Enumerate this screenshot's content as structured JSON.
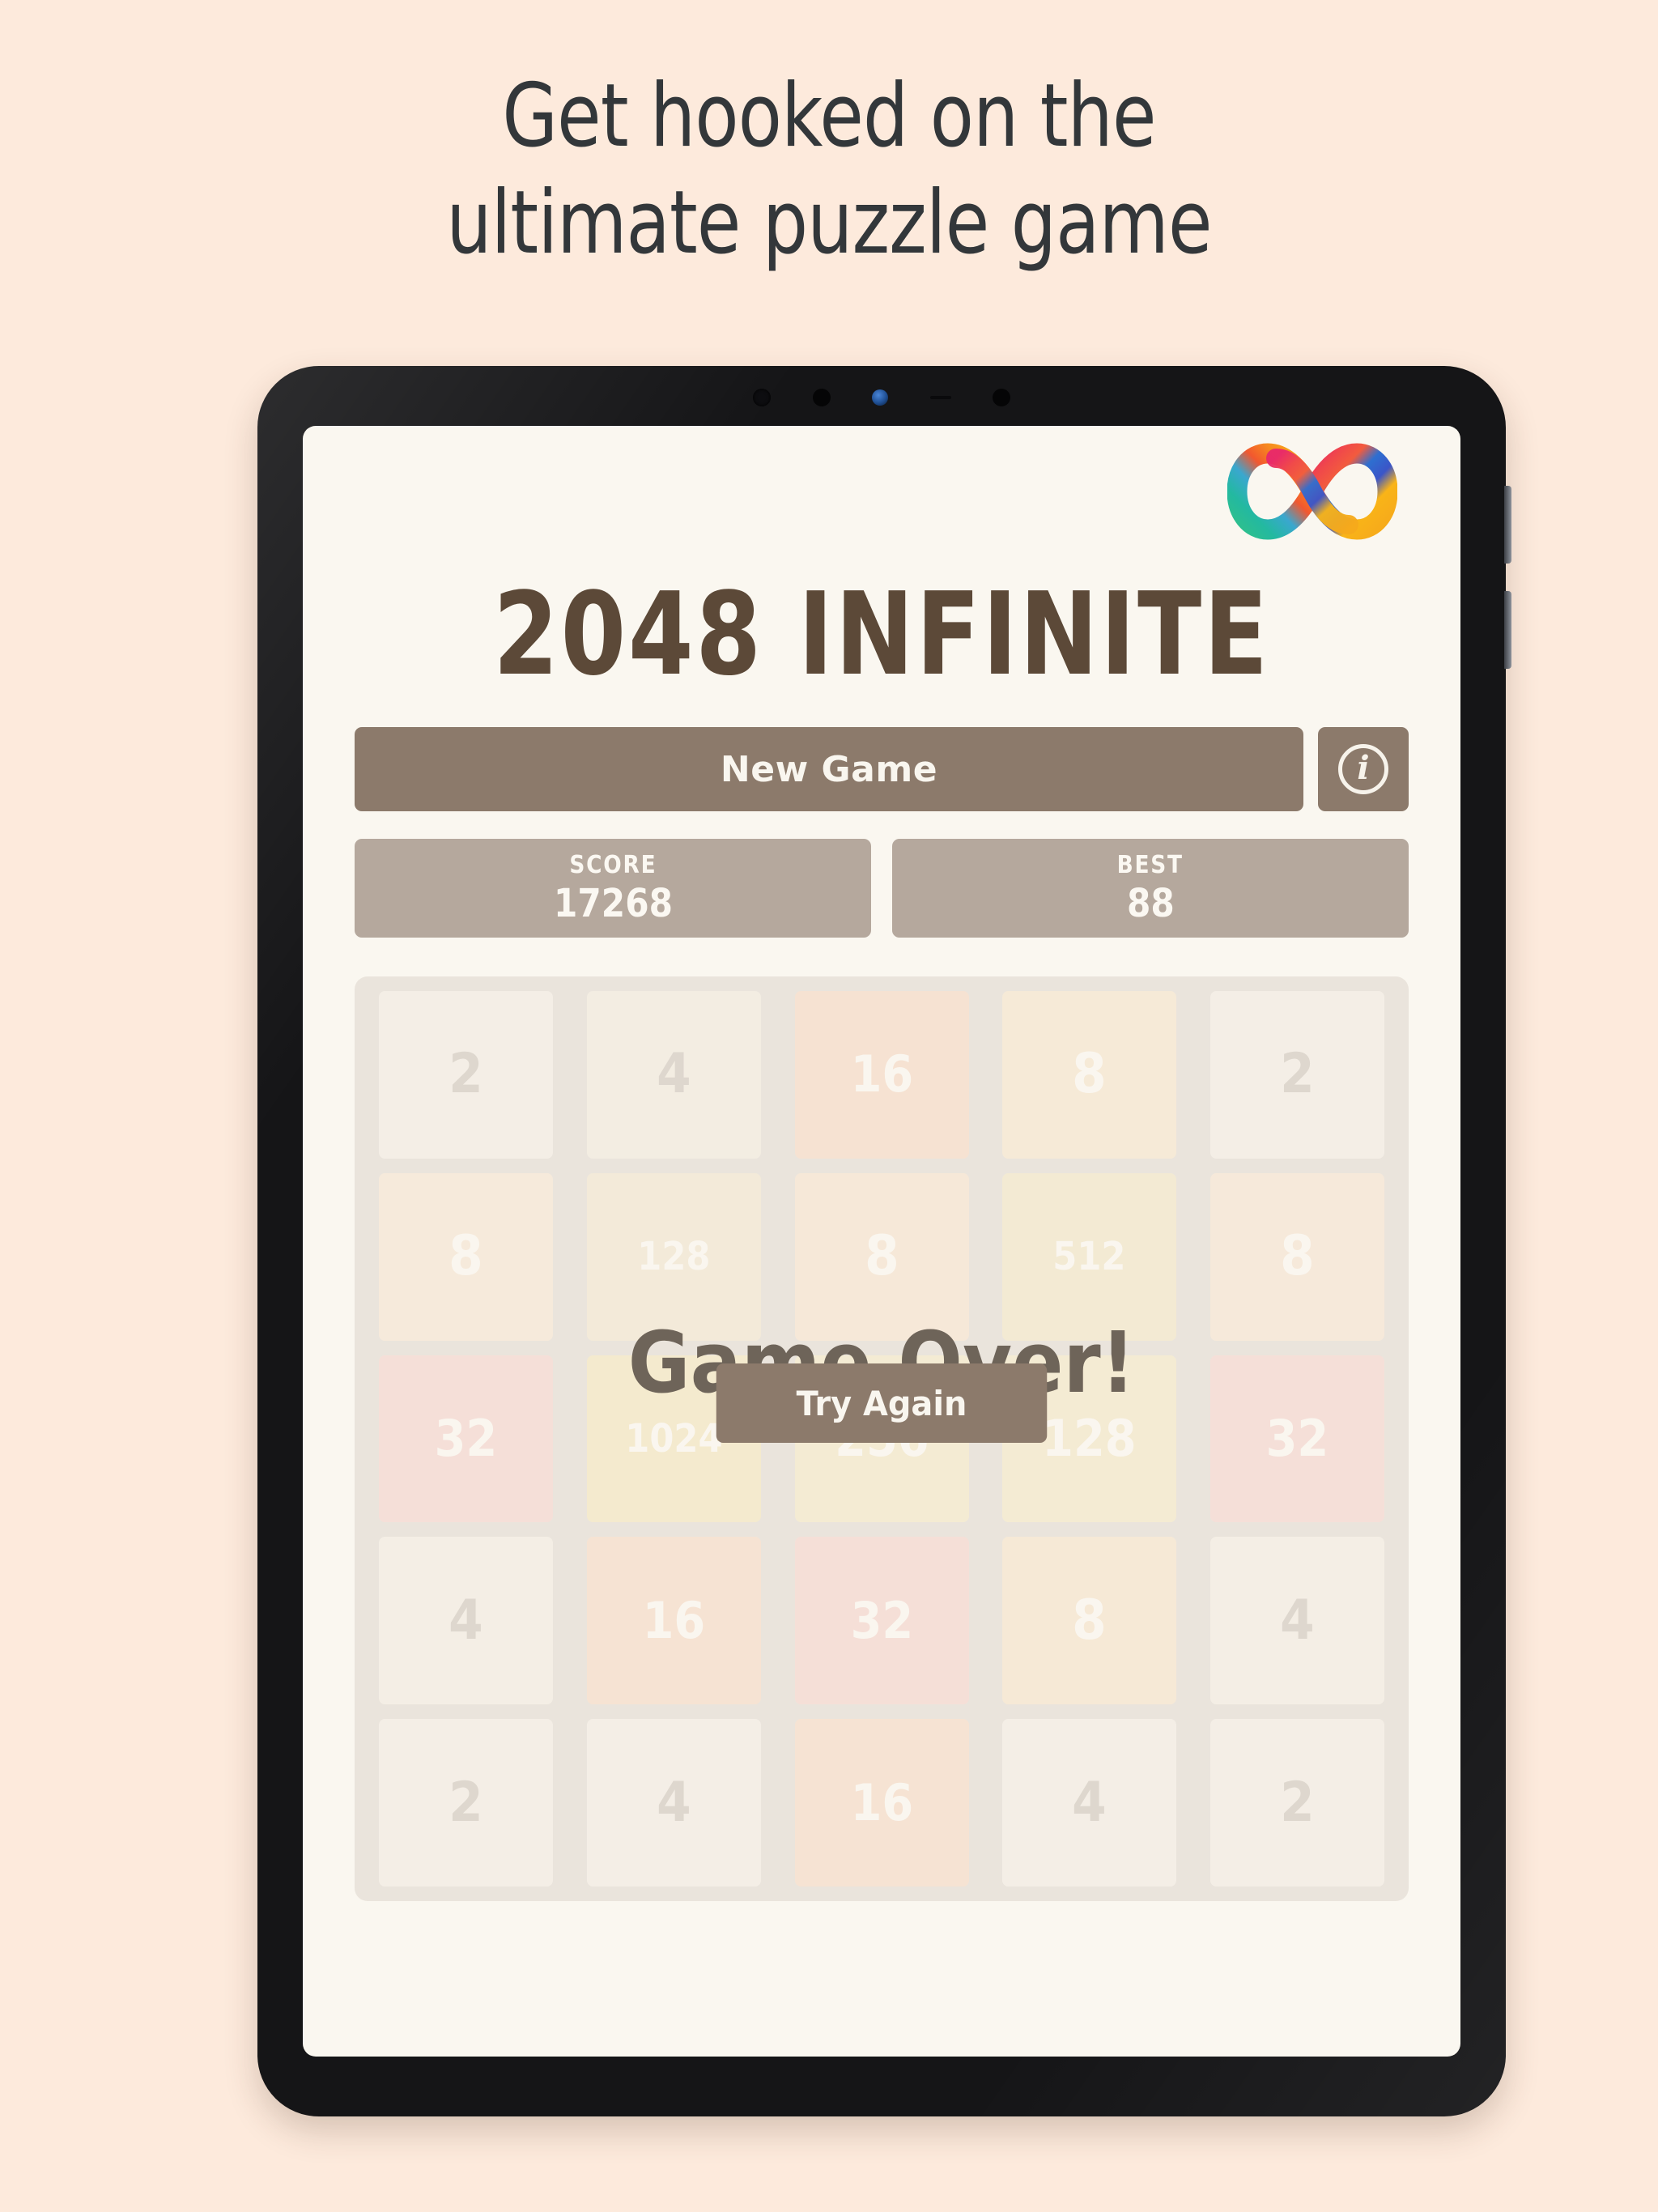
{
  "promo": {
    "headline_line1": "Get hooked on the",
    "headline_line2": "ultimate puzzle game",
    "background_color": "#FDEADC",
    "headline_color": "#33373A"
  },
  "device": {
    "type": "tablet",
    "bezel_color": "#151517",
    "screen_background": "#FAF7F0",
    "camera_icons": [
      "camera-dot",
      "camera-dot",
      "proximity-sensor",
      "camera-dot"
    ],
    "side_buttons": [
      "volume-up-button",
      "volume-down-button"
    ]
  },
  "app": {
    "logo_icon": "infinity-logo-icon",
    "logo_colors": [
      "#E8276B",
      "#F0474B",
      "#F47A20",
      "#F9B418",
      "#2E6FD0",
      "#18A48C",
      "#2FC08B"
    ],
    "title": "2048 INFINITE",
    "title_color": "#5C4938",
    "accent_color": "#8C7A6B",
    "score_box_color": "#B5A89D"
  },
  "toolbar": {
    "new_game_label": "New Game",
    "info_icon": "info-circle-icon",
    "info_glyph": "i"
  },
  "scores": [
    {
      "label": "SCORE",
      "value": "17268"
    },
    {
      "label": "BEST",
      "value": "88"
    }
  ],
  "board": {
    "columns": 5,
    "rows": 5,
    "container_color": "#D8CFC6",
    "tiles": [
      [
        {
          "value": "2",
          "bg": "#EDE4DA",
          "fg": "#BDB2A6",
          "size": "s-lg"
        },
        {
          "value": "4",
          "bg": "#EBE1D3",
          "fg": "#BDB2A6",
          "size": "s-lg"
        },
        {
          "value": "16",
          "bg": "#F3C9AE",
          "fg": "#FAF6EF",
          "size": "s-md"
        },
        {
          "value": "8",
          "bg": "#F3DBB9",
          "fg": "#FAF6EF",
          "size": "s-lg"
        },
        {
          "value": "2",
          "bg": "#EDE4DA",
          "fg": "#BDB2A6",
          "size": "s-lg"
        }
      ],
      [
        {
          "value": "8",
          "bg": "#F3DBC2",
          "fg": "#FAF6EF",
          "size": "s-lg"
        },
        {
          "value": "128",
          "bg": "#EBDCBE",
          "fg": "#FAF6EF",
          "size": "s-sm"
        },
        {
          "value": "8",
          "bg": "#F3D7BC",
          "fg": "#FAF6EF",
          "size": "s-lg"
        },
        {
          "value": "512",
          "bg": "#EBDCB2",
          "fg": "#FAF6EF",
          "size": "s-sm"
        },
        {
          "value": "8",
          "bg": "#F3D9C0",
          "fg": "#FAF6EF",
          "size": "s-lg"
        }
      ],
      [
        {
          "value": "32",
          "bg": "#F1C4BC",
          "fg": "#FAF6EF",
          "size": "s-md"
        },
        {
          "value": "1024",
          "bg": "#EEDCA6",
          "fg": "#FAF6EF",
          "size": "s-sm"
        },
        {
          "value": "256",
          "bg": "#EEDEB2",
          "fg": "#FAF6EF",
          "size": "s-md"
        },
        {
          "value": "128",
          "bg": "#EEDEB2",
          "fg": "#FAF6EF",
          "size": "s-md"
        },
        {
          "value": "32",
          "bg": "#F1C4BC",
          "fg": "#FAF6EF",
          "size": "s-md"
        }
      ],
      [
        {
          "value": "4",
          "bg": "#EDE4D8",
          "fg": "#BDB2A6",
          "size": "s-lg"
        },
        {
          "value": "16",
          "bg": "#F3CDB2",
          "fg": "#FAF6EF",
          "size": "s-md"
        },
        {
          "value": "32",
          "bg": "#F1C3BB",
          "fg": "#FAF6EF",
          "size": "s-md"
        },
        {
          "value": "8",
          "bg": "#F3D9B8",
          "fg": "#FAF6EF",
          "size": "s-lg"
        },
        {
          "value": "4",
          "bg": "#EDE4D8",
          "fg": "#BDB2A6",
          "size": "s-lg"
        }
      ],
      [
        {
          "value": "2",
          "bg": "#EDE4DA",
          "fg": "#BDB2A6",
          "size": "s-lg"
        },
        {
          "value": "4",
          "bg": "#EDE4DA",
          "fg": "#BDB2A6",
          "size": "s-lg"
        },
        {
          "value": "16",
          "bg": "#F3CCB0",
          "fg": "#FAF6EF",
          "size": "s-md"
        },
        {
          "value": "4",
          "bg": "#EDE4DA",
          "fg": "#BDB2A6",
          "size": "s-lg"
        },
        {
          "value": "2",
          "bg": "#EDE4DA",
          "fg": "#BDB2A6",
          "size": "s-lg"
        }
      ]
    ]
  },
  "game_over": {
    "message": "Game Over!",
    "message_color": "#6E6459",
    "try_again_label": "Try Again"
  }
}
